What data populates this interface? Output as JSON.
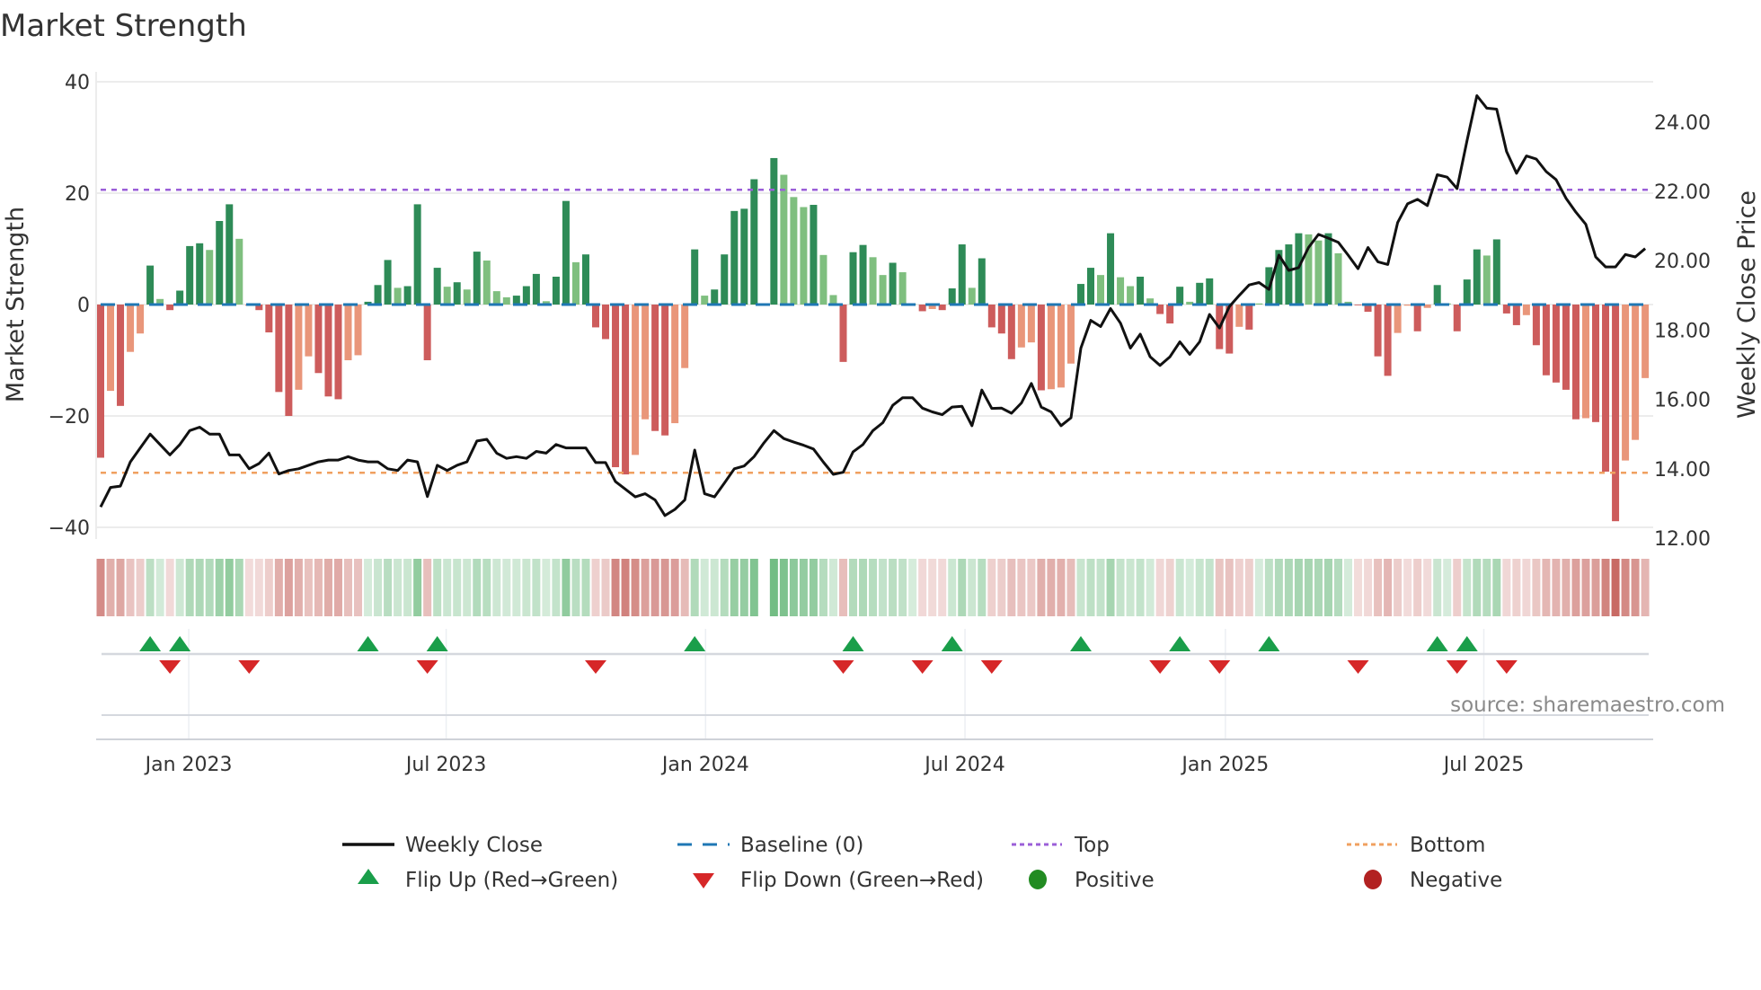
{
  "chart_data": {
    "type": "bar",
    "title": "Market Strength",
    "ylabel": "Market Strength",
    "ylabel_right": "Weekly Close Price",
    "ylim": [
      -42,
      42
    ],
    "ylim_right": [
      11.2,
      25.7
    ],
    "yticks": [
      "40",
      "20",
      "0",
      "−20",
      "−40"
    ],
    "ytick_values": [
      40,
      20,
      0,
      -20,
      -40
    ],
    "yticks_right": [
      "24.00",
      "22.00",
      "20.00",
      "18.00",
      "16.00",
      "14.00",
      "12.00"
    ],
    "ytick_right_values": [
      24,
      22,
      20,
      18,
      16,
      14,
      12
    ],
    "x_unit": "week index",
    "xticks": [
      {
        "label": "Jan 2023",
        "week": 8.9
      },
      {
        "label": "Jul 2023",
        "week": 34.9
      },
      {
        "label": "Jan 2024",
        "week": 61.1
      },
      {
        "label": "Jul 2024",
        "week": 87.3
      },
      {
        "label": "Jan 2025",
        "week": 113.6
      },
      {
        "label": "Jul 2025",
        "week": 139.7
      }
    ],
    "top": 20.6,
    "bottom": -30.2,
    "strength": [
      -27.5,
      -15.5,
      -18.2,
      -8.5,
      -5.2,
      7,
      1,
      -1,
      2.5,
      10.5,
      11,
      9.8,
      15,
      18,
      11.8,
      -0.2,
      -1,
      -5,
      -15.7,
      -20,
      -15.3,
      -9.3,
      -12.3,
      -16.5,
      -17,
      -10,
      -9.1,
      0.5,
      3.5,
      8,
      3,
      3.3,
      18,
      -10,
      6.6,
      3.2,
      4,
      2.7,
      9.5,
      7.9,
      2.4,
      1.3,
      1.6,
      3.3,
      5.5,
      0.6,
      5,
      18.6,
      7.6,
      9,
      -4.1,
      -6.2,
      -29.2,
      -30.5,
      -27,
      -20.6,
      -22.7,
      -23.5,
      -21.3,
      -11.4,
      9.9,
      1.6,
      2.7,
      9,
      16.8,
      17.2,
      22.5,
      0,
      26.3,
      23.3,
      19.3,
      17.5,
      17.9,
      8.9,
      1.7,
      -10.3,
      9.4,
      10.7,
      8.5,
      5.3,
      7.5,
      5.8,
      0.1,
      -1.2,
      -0.8,
      -1,
      2.9,
      10.8,
      3,
      8.3,
      -4.1,
      -5.2,
      -9.8,
      -7.7,
      -6.8,
      -15.4,
      -15.2,
      -14.9,
      -10.6,
      3.7,
      6.6,
      5.3,
      12.8,
      4.9,
      3.3,
      5,
      1.1,
      -1.7,
      -3.4,
      3.2,
      0.5,
      3.9,
      4.7,
      -8,
      -8.8,
      -4,
      -4.5,
      0.2,
      6.7,
      9.8,
      10.8,
      12.8,
      12.6,
      11.5,
      12.8,
      9.2,
      0.5,
      -0.1,
      -1.3,
      -9.3,
      -12.8,
      -5.1,
      -0.2,
      -4.8,
      -0.6,
      3.5,
      0.2,
      -4.8,
      4.5,
      9.9,
      8.8,
      11.7,
      -1.6,
      -3.7,
      -1.9,
      -7.3,
      -12.7,
      -14,
      -15.3,
      -20.6,
      -20.4,
      -21.1,
      -30,
      -38.9,
      -28,
      -24.3,
      -13.2
    ],
    "strength_shade": "RrRrrGgRGGGgGGgRRRRRrrRRRrrGGGgGGRGgGgGgggGGGgGGgGRRRRrrRRrrGgGGGGGGGgggGggRGGggGggRrRGGgGRRRrrRrrrGGgGggGgRRGgGGRRrRgGGGGggGggRRRRrrRrGgRGGgGRRrRRRRRrRRRrrr",
    "weekly_close": [
      12.9,
      13.46,
      13.5,
      14.2,
      14.6,
      15.0,
      14.7,
      14.4,
      14.7,
      15.1,
      15.2,
      15.0,
      15.0,
      14.4,
      14.4,
      14.0,
      14.15,
      14.45,
      13.85,
      13.95,
      14.0,
      14.1,
      14.2,
      14.25,
      14.25,
      14.35,
      14.25,
      14.2,
      14.2,
      14.0,
      13.95,
      14.25,
      14.2,
      13.2,
      14.1,
      13.95,
      14.1,
      14.2,
      14.8,
      14.85,
      14.45,
      14.3,
      14.35,
      14.3,
      14.5,
      14.45,
      14.7,
      14.6,
      14.6,
      14.6,
      14.18,
      14.18,
      13.63,
      13.41,
      13.19,
      13.28,
      13.1,
      12.65,
      12.83,
      13.1,
      14.54,
      13.28,
      13.19,
      13.59,
      14.0,
      14.08,
      14.35,
      14.75,
      15.1,
      14.87,
      14.77,
      14.68,
      14.57,
      14.19,
      13.84,
      13.9,
      14.49,
      14.7,
      15.1,
      15.33,
      15.83,
      16.05,
      16.05,
      15.75,
      15.64,
      15.56,
      15.78,
      15.8,
      15.24,
      16.27,
      15.74,
      15.75,
      15.6,
      15.9,
      16.46,
      15.78,
      15.64,
      15.24,
      15.47,
      17.48,
      18.28,
      18.1,
      18.62,
      18.2,
      17.48,
      17.88,
      17.23,
      16.98,
      17.23,
      17.66,
      17.3,
      17.66,
      18.45,
      18.06,
      18.68,
      19.0,
      19.3,
      19.37,
      19.17,
      20.16,
      19.72,
      19.8,
      20.38,
      20.76,
      20.65,
      20.53,
      20.16,
      19.77,
      20.38,
      19.97,
      19.89,
      21.1,
      21.64,
      21.77,
      21.59,
      22.48,
      22.41,
      22.08,
      23.46,
      24.76,
      24.4,
      24.37,
      23.15,
      22.52,
      23.02,
      22.93,
      22.57,
      22.34,
      21.8,
      21.4,
      21.05,
      20.11,
      19.82,
      19.82,
      20.18,
      20.11,
      20.35
    ],
    "flip_up_weeks": [
      5,
      8,
      27,
      34,
      60,
      76,
      86,
      99,
      109,
      118,
      135,
      138
    ],
    "flip_down_weeks": [
      7,
      15,
      33,
      50,
      75,
      83,
      90,
      107,
      113,
      127,
      137,
      142
    ],
    "legend": [
      {
        "label": "Weekly Close",
        "kind": "line"
      },
      {
        "label": "Baseline (0)",
        "kind": "dash"
      },
      {
        "label": "Top",
        "kind": "dotted-top"
      },
      {
        "label": "Bottom",
        "kind": "dotted-bottom"
      },
      {
        "label": "Flip Up (Red→Green)",
        "kind": "up"
      },
      {
        "label": "Flip Down (Green→Red)",
        "kind": "down"
      },
      {
        "label": "Positive",
        "kind": "pos"
      },
      {
        "label": "Negative",
        "kind": "neg"
      }
    ],
    "legend_placement": "bottom",
    "grid": true,
    "source": "source: sharemaestro.com"
  },
  "colors": {
    "G": "#2e8b57",
    "g": "#7fbf7f",
    "R": "#cd5c5c",
    "r": "#e9967a",
    "line": "#111111",
    "baseline": "#1f77b4",
    "top": "#9b5fd8",
    "bottom": "#f0a060",
    "up": "#1a9e4a",
    "down": "#d62728",
    "pos": "#228b22",
    "neg": "#b22222"
  }
}
